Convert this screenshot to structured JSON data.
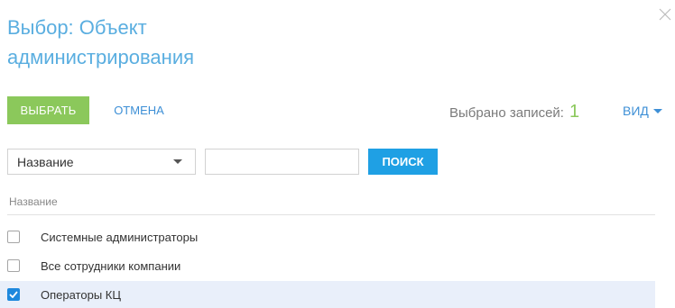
{
  "dialog": {
    "title": "Выбор: Объект администрирования",
    "close_icon": "close-icon"
  },
  "toolbar": {
    "select_label": "ВЫБРАТЬ",
    "cancel_label": "ОТМЕНА",
    "selected_label": "Выбрано записей:",
    "selected_count": "1",
    "view_label": "ВИД"
  },
  "filter": {
    "column_value": "Название",
    "search_value": "",
    "search_button": "ПОИСК"
  },
  "table": {
    "column_header": "Название",
    "rows": [
      {
        "name": "Системные администраторы",
        "checked": false
      },
      {
        "name": "Все сотрудники компании",
        "checked": false
      },
      {
        "name": "Операторы КЦ",
        "checked": true
      }
    ]
  },
  "colors": {
    "title": "#5aaee0",
    "select_button": "#8bc85b",
    "search_button": "#1fa0e4",
    "link": "#3d8fd6",
    "selected_row": "#e9effa",
    "checkbox_checked": "#1e88dd"
  }
}
